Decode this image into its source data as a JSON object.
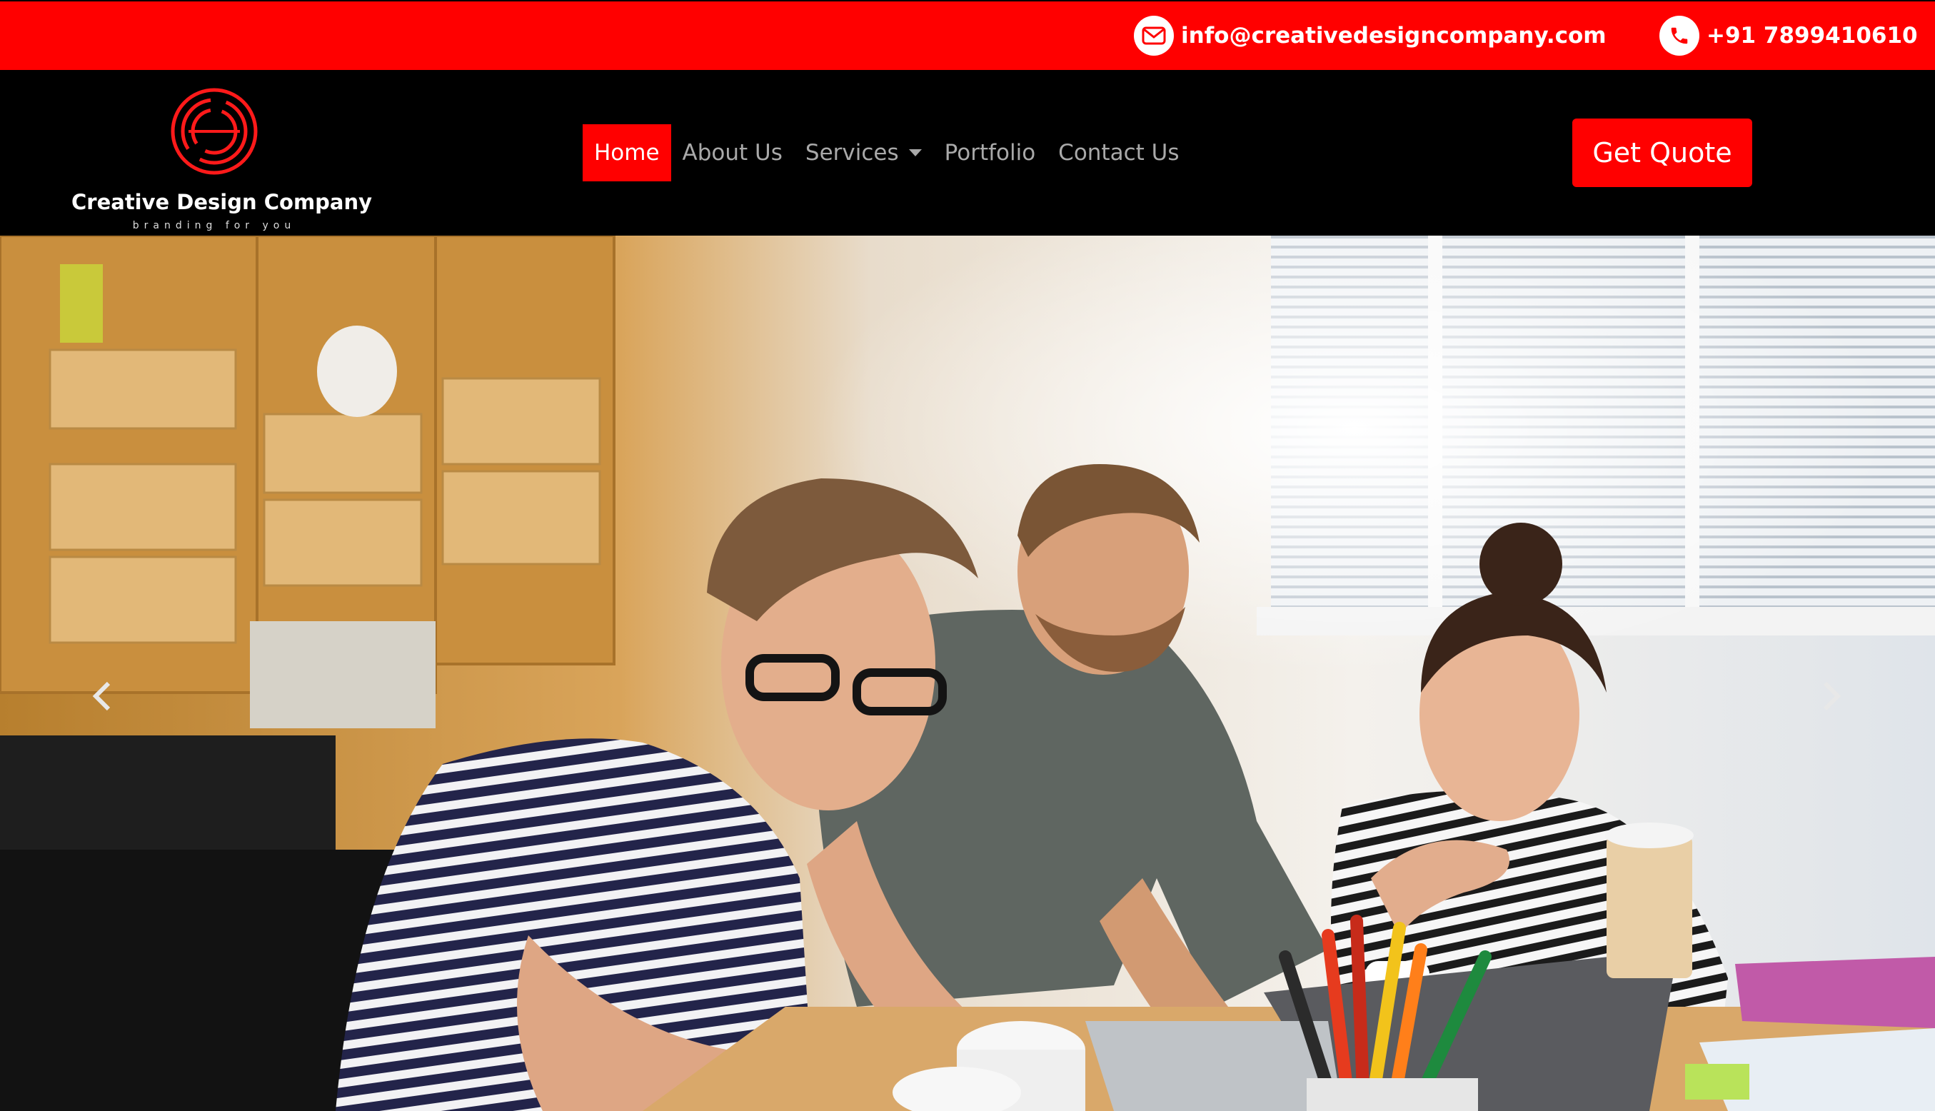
{
  "topbar": {
    "email": "info@creativedesigncompany.com",
    "email_icon": "envelope-icon",
    "phone": "+91 7899410610",
    "phone_icon": "phone-icon",
    "background_color": "#ff0000"
  },
  "brand": {
    "name": "Creative Design Company",
    "tagline": "branding for you",
    "logo_icon": "circular-logo-mark"
  },
  "nav": {
    "items": [
      {
        "label": "Home",
        "active": true
      },
      {
        "label": "About Us",
        "active": false
      },
      {
        "label": "Services",
        "active": false,
        "has_dropdown": true
      },
      {
        "label": "Portfolio",
        "active": false
      },
      {
        "label": "Contact Us",
        "active": false
      }
    ],
    "cta_label": "Get Quote",
    "accent_color": "#ff0000"
  },
  "hero": {
    "image_icon": "team-at-laptop-photo",
    "prev_icon": "chevron-left-icon",
    "next_icon": "chevron-right-icon"
  }
}
